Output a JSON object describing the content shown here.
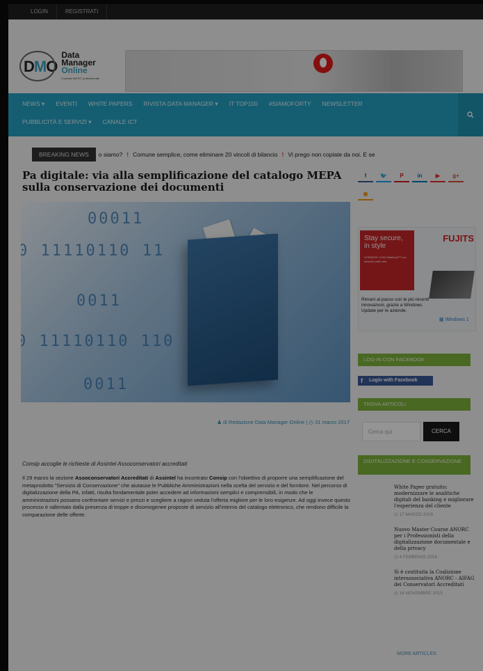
{
  "topbar": {
    "items": [
      "LOGIN",
      "REGISTRATI"
    ]
  },
  "logo": {
    "mark_d": "D",
    "mark_m": "M",
    "mark_o": "O",
    "line1": "Data",
    "line2": "Manager",
    "line3": "Online",
    "tagline": "Il portale dell'ICT professionale"
  },
  "nav": {
    "row1": [
      "NEWS ▾",
      "EVENTI",
      "WHITE PAPERS",
      "RIVISTA DATA MANAGER ▾",
      "IT TOP100",
      "#SIAMOFORTY",
      "NEWSLETTER"
    ],
    "row2": [
      "PUBBLICITÀ E SERVIZI ▾",
      "CANALE ICT"
    ],
    "search_icon": "search-icon"
  },
  "breaking": {
    "label": "BREAKING NEWS",
    "items": [
      "o siamo?",
      "Comune semplice, come eliminare 20 vincoli di bilancio",
      "Vi prego non copiate da noi. E se"
    ]
  },
  "article": {
    "title": "Pa digitale: via alla semplificazione del catalogo MEPA sulla conservazione dei documenti",
    "byline_author": "di Redazione Data Manager Online",
    "byline_date": "31 marzo 2017",
    "lead": "Consip accoglie le richieste di Assintel Assoconservatori accreditati",
    "body_1": "Il 29 marzo la sezione ",
    "body_b1": "Assoconservatori Accreditati",
    "body_2": " di ",
    "body_b2": "Assintel",
    "body_3": " ha incontrato ",
    "body_b3": "Consip",
    "body_4": " con l'obiettivo di proporre una semplificazione del metaprodotto \"Servizio di Conservazione\" che aiutasse le Pubbliche Amministrazioni nella scelta del servizio e del fornitore. Nel percorso di digitalizzazione della PA, infatti, risulta fondamentale poter accedere ad informazioni semplici e comprensibili, in modo che le amministrazioni possano confrontare servizi e prezzi e scegliere a ragion veduta l'offerta migliore per le loro esigenze. Ad oggi invece questo processo è rallentato dalla presenza di troppe e disomogenee proposte di servizio all'interno  del catalogo elettronico, che rendono difficile la comparazione delle offerte.",
    "hero_bits": [
      "00011",
      "0 11110110 11",
      "0011",
      "0 11110110 110",
      "0011"
    ]
  },
  "sidebar": {
    "social": [
      {
        "glyph": "f",
        "name": "facebook-icon",
        "color": "#3b5998"
      },
      {
        "glyph": "🐦",
        "name": "twitter-icon",
        "color": "#1da1f2"
      },
      {
        "glyph": "P",
        "name": "pinterest-icon",
        "color": "#cb2027"
      },
      {
        "glyph": "in",
        "name": "linkedin-icon",
        "color": "#0077b5"
      },
      {
        "glyph": "▶",
        "name": "youtube-icon",
        "color": "#e52d27"
      },
      {
        "glyph": "g+",
        "name": "googleplus-icon",
        "color": "#dd4b39"
      },
      {
        "glyph": "◉",
        "name": "rss-icon",
        "color": "#f39c12"
      }
    ],
    "ad": {
      "brand": "FUJITS",
      "headline": "Stay secure, in style",
      "small": "LIFEBOOK U745 Ultrabook™ con sensore palm vein",
      "copy": "Rimani al passo con le più recenti innovazioni, grazie a Windows Update per le aziende.",
      "windows": "Windows 1"
    },
    "facebook_label": "LOG-IN CON FACEBOOK",
    "facebook_button": "Login with Facebook",
    "search_label": "TROVA ARTICOLI",
    "search_placeholder": "Cerca qui",
    "search_button": "CERCA",
    "category_label": "DIGITALIZZAZIONE E CONSERVAZIONE",
    "articles": [
      {
        "title": "White Paper gratuito: modernizzare le analitiche digitali del banking e migliorare l'esperienza del cliente",
        "date": "17 MARZO 2016"
      },
      {
        "title": "Nuovo Master Course ANORC per i Professionisti della digitalizzazione documentale e della privacy",
        "date": "4 FEBBRAIO 2016"
      },
      {
        "title": "Si è costituita la Coalizione interassociativa ANORC - AIFAG dei Conservatori Accreditati",
        "date": "16 NOVEMBRE 2015"
      }
    ],
    "more": "MORE ARTICLES"
  }
}
